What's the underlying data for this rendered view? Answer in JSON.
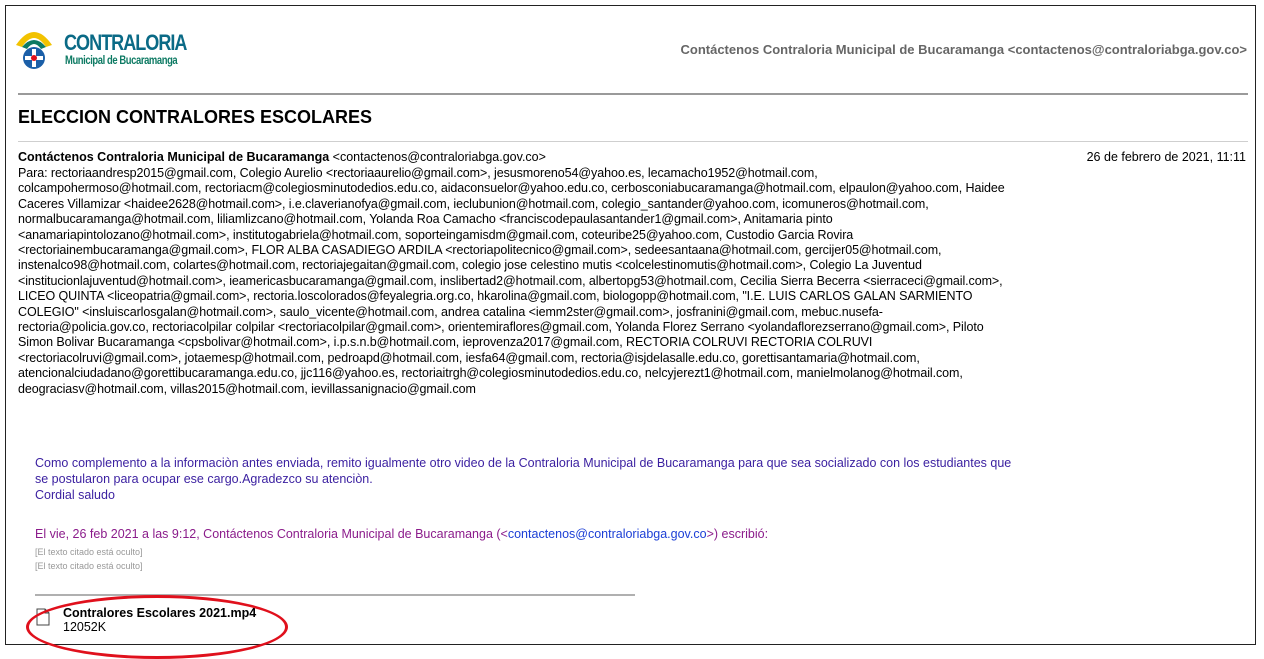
{
  "logo": {
    "title": "CONTRALORIA",
    "subtitle": "Municipal de Bucaramanga",
    "colors": {
      "primary": "#0a6a86",
      "secondary": "#0d7a63",
      "accent": "#f2c200"
    }
  },
  "header": {
    "account": "Contáctenos Contraloria Municipal de Bucaramanga <contactenos@contraloriabga.gov.co>"
  },
  "message": {
    "subject": "ELECCION CONTRALORES ESCOLARES",
    "from_name": "Contáctenos Contraloria Municipal de Bucaramanga",
    "from_email": " <contactenos@contraloriabga.gov.co>",
    "date": "26 de febrero de 2021, 11:11",
    "recipients": "Para: rectoriaandresp2015@gmail.com, Colegio Aurelio <rectoriaaurelio@gmail.com>, jesusmoreno54@yahoo.es, lecamacho1952@hotmail.com,\ncolcampohermoso@hotmail.com, rectoriacm@colegiosminutodedios.edu.co, aidaconsuelor@yahoo.edu.co, cerbosconiabucaramanga@hotmail.com, elpaulon@yahoo.com, Haidee\nCaceres Villamizar <haidee2628@hotmail.com>, i.e.claverianofya@gmail.com, ieclubunion@hotmail.com, colegio_santander@yahoo.com, icomuneros@hotmail.com,\nnormalbucaramanga@hotmail.com, liliamlizcano@hotmail.com, Yolanda Roa Camacho <franciscodepaulasantander1@gmail.com>, Anitamaria pinto\n<anamariapintolozano@hotmail.com>, institutogabriela@hotmail.com, soporteingamisdm@gmail.com, coteuribe25@yahoo.com, Custodio Garcia Rovira\n<rectoriainembucaramanga@gmail.com>, FLOR ALBA CASADIEGO ARDILA <rectoriapolitecnico@gmail.com>, sedeesantaana@hotmail.com, gercijer05@hotmail.com,\ninstenalco98@hotmail.com, colartes@hotmail.com, rectoriajegaitan@gmail.com, colegio jose celestino mutis <colcelestinomutis@hotmail.com>, Colegio La Juventud\n<institucionlajuventud@hotmail.com>, ieamericasbucaramanga@gmail.com, inslibertad2@hotmail.com, albertopg53@hotmail.com, Cecilia Sierra Becerra <sierraceci@gmail.com>,\nLICEO QUINTA <liceopatria@gmail.com>, rectoria.loscolorados@feyalegria.org.co, hkarolina@gmail.com, biologopp@hotmail.com, \"I.E. LUIS CARLOS GALAN SARMIENTO\nCOLEGIO\" <insluiscarlosgalan@hotmail.com>, saulo_vicente@hotmail.com, andrea catalina <iemm2ster@gmail.com>, josfranini@gmail.com, mebuc.nusefa-\nrectoria@policia.gov.co, rectoriacolpilar colpilar <rectoriacolpilar@gmail.com>, orientemiraflores@gmail.com, Yolanda Florez Serrano <yolandaflorezserrano@gmail.com>, Piloto\nSimon Bolivar Bucaramanga <cpsbolivar@hotmail.com>, i.p.s.n.b@hotmail.com, ieprovenza2017@gmail.com, RECTORIA COLRUVI RECTORIA COLRUVI\n<rectoriacolruvi@gmail.com>, jotaemesp@hotmail.com, pedroapd@hotmail.com, iesfa64@gmail.com, rectoria@isjdelasalle.edu.co, gorettisantamaria@hotmail.com,\natencionalciudadano@gorettibucaramanga.edu.co, jjc116@yahoo.es, rectoriaitrgh@colegiosminutodedios.edu.co, nelcyjerezt1@hotmail.com, manielmolanog@hotmail.com,\ndeograciasv@hotmail.com, villas2015@hotmail.com, ievillassanignacio@gmail.com",
    "body": "Como complemento a la informaciòn antes enviada, remito igualmente otro video de la Contraloria Municipal de Bucaramanga para que sea socializado con los estudiantes que\nse postularon para ocupar ese cargo.Agradezco su atenciòn.\nCordial saludo",
    "quote_prefix": "El vie, 26 feb 2021 a las 9:12, Contáctenos Contraloria Municipal de Bucaramanga (<",
    "quote_link": "contactenos@contraloriabga.gov.co",
    "quote_suffix": ">) escribió:",
    "hidden_text_1": "[El texto citado está oculto]",
    "hidden_text_2": "[El texto citado está oculto]"
  },
  "attachment": {
    "name": "Contralores Escolares 2021.mp4",
    "size": "12052K",
    "icon": "file-icon",
    "highlight_color": "#e0101c"
  }
}
